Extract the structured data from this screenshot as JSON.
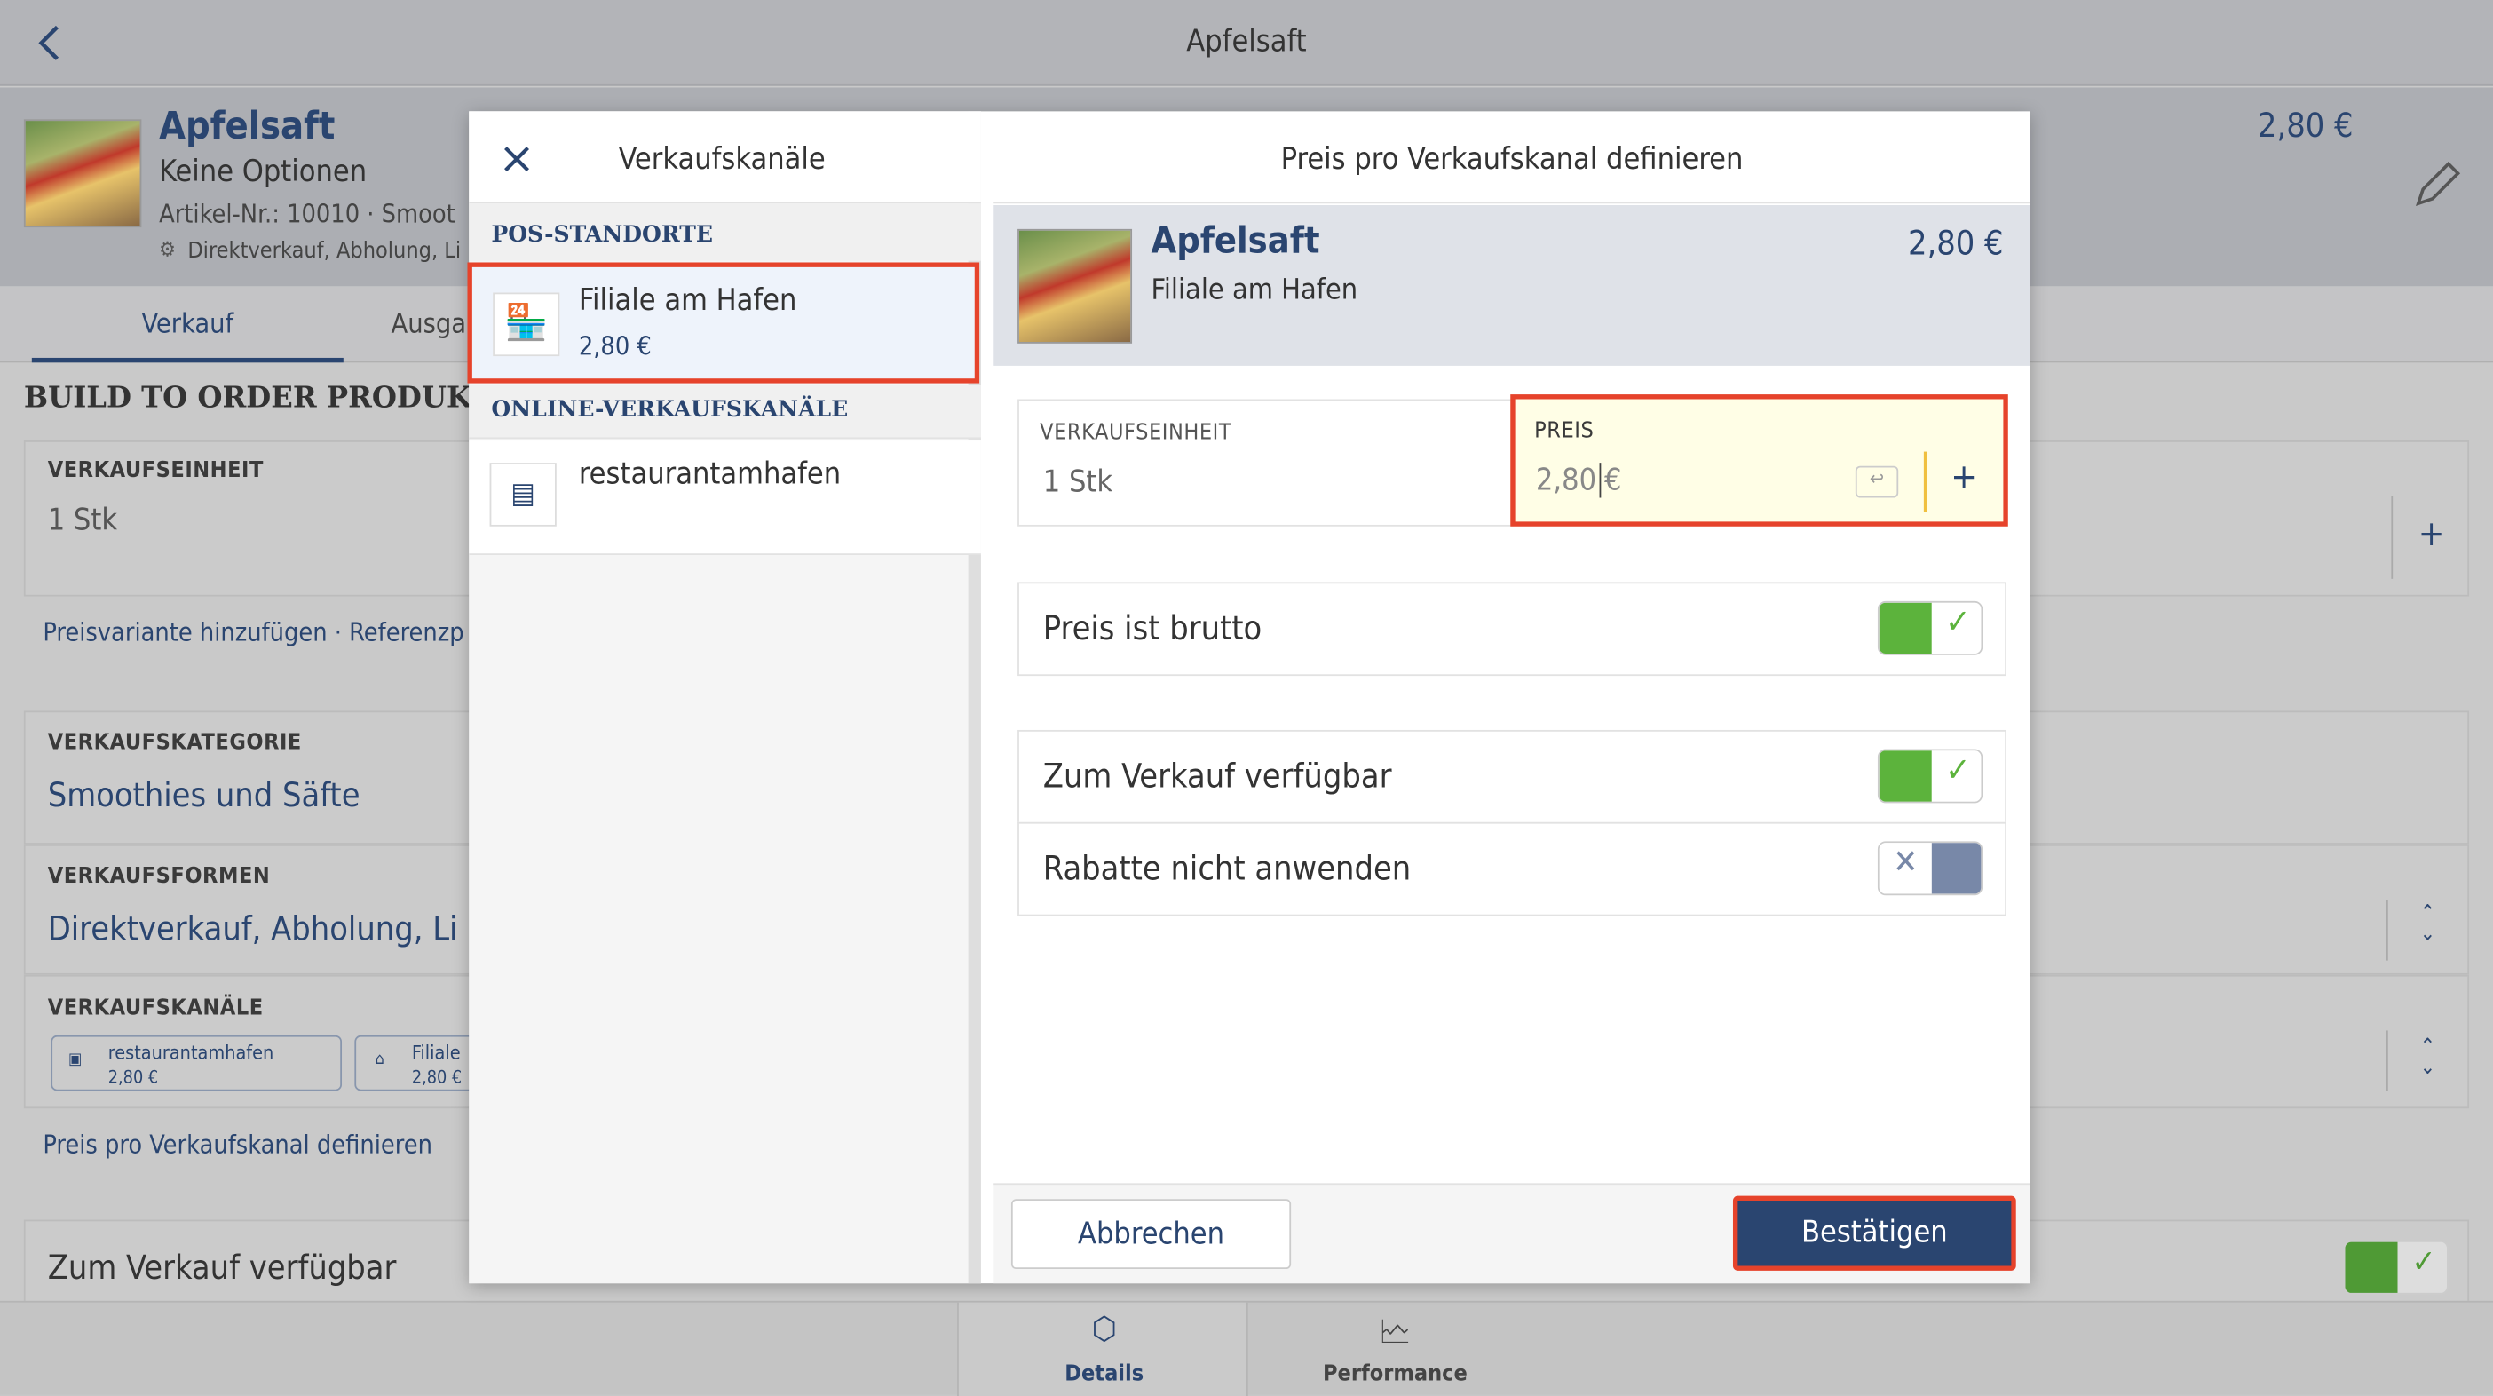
{
  "topbar": {
    "title": "Apfelsaft"
  },
  "product": {
    "name": "Apfelsaft",
    "options": "Keine Optionen",
    "article": "Artikel-Nr.: 10010 · Smoot",
    "forms_summary": "Direktverkauf, Abholung, Li",
    "price": "2,80 €"
  },
  "tabs": [
    {
      "label": "Verkauf",
      "active": true
    },
    {
      "label": "Ausga"
    }
  ],
  "background": {
    "section_title": "BUILD TO ORDER PRODUKT",
    "unit_label": "VERKAUFSEINHEIT",
    "unit_value": "1 Stk",
    "links": "Preisvariante hinzufügen · Referenzp",
    "category_label": "VERKAUFSKATEGORIE",
    "category_value": "Smoothies und Säfte",
    "forms_label": "VERKAUFSFORMEN",
    "forms_value": "Direktverkauf, Abholung, Li",
    "channels_label": "VERKAUFSKANÄLE",
    "channels": [
      {
        "name": "restaurantamhafen",
        "price": "2,80 €"
      },
      {
        "name": "Filiale",
        "price": "2,80 €"
      }
    ],
    "define_link": "Preis pro Verkaufskanal definieren",
    "available_label": "Zum Verkauf verfügbar"
  },
  "nav": [
    {
      "label": "Details",
      "icon": "box-icon",
      "active": true
    },
    {
      "label": "Performance",
      "icon": "chart-document-icon"
    }
  ],
  "modal": {
    "left_title": "Verkaufskanäle",
    "pos_header": "POS-STANDORTE",
    "pos_items": [
      {
        "name": "Filiale am Hafen",
        "price": "2,80 €",
        "selected": true
      }
    ],
    "online_header": "ONLINE-VERKAUFSKANÄLE",
    "online_items": [
      {
        "name": "restaurantamhafen"
      }
    ],
    "right_title": "Preis pro Verkaufskanal definieren",
    "product_name": "Apfelsaft",
    "channel": "Filiale am Hafen",
    "price": "2,80 €",
    "unit_label": "VERKAUFSEINHEIT",
    "unit_value": "1 Stk",
    "price_label": "PREIS",
    "price_value": "2,80",
    "currency": "€",
    "toggles": [
      {
        "label": "Preis ist brutto",
        "on": true
      },
      {
        "label": "Zum Verkauf verfügbar",
        "on": true
      },
      {
        "label": "Rabatte nicht anwenden",
        "on": false
      }
    ],
    "cancel": "Abbrechen",
    "confirm": "Bestätigen"
  },
  "colors": {
    "accent": "#2a4570",
    "toggle_on": "#5cb33c",
    "highlight": "#e6432b",
    "confirm": "#2a4570"
  }
}
